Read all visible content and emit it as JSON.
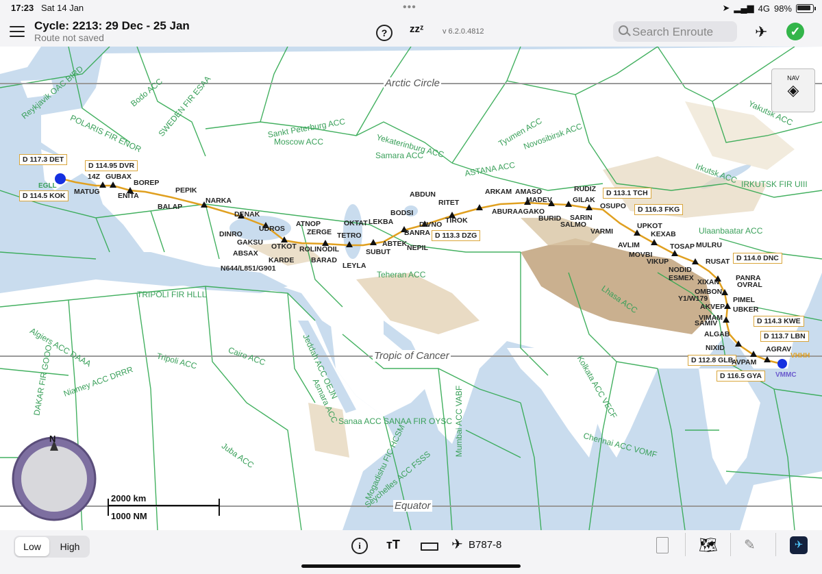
{
  "status_bar": {
    "time": "17:23",
    "date": "Sat 14 Jan",
    "network": "4G",
    "battery": "98%"
  },
  "header": {
    "cycle": "Cycle: 2213: 29 Dec - 25 Jan",
    "route_status": "Route not saved",
    "version": "v 6.2.0.4812",
    "search_placeholder": "Search Enroute",
    "sleep_label": "zzᶻ"
  },
  "map": {
    "lines": {
      "arctic": "Arctic Circle",
      "tropic": "Tropic of Cancer",
      "equator": "Equator"
    },
    "nav_button_label": "NAV",
    "compass_label": "N",
    "scale_km": "2000 km",
    "scale_nm": "1000 NM",
    "regions": [
      "Reykjavik OAC BIRD",
      "Bodo ACC",
      "SWEDEN FIR ESAA",
      "POLARIS FIR ENOR",
      "Sankt Peterburg ACC",
      "Moscow ACC",
      "Yekaterinburg ACC",
      "Samara ACC",
      "Tyumen ACC",
      "Novosibirsk ACC",
      "Yakutsk ACC",
      "ASTANA ACC",
      "Irkutsk ACC",
      "IRKUTSK FIR UIII",
      "Ulaanbaatar ACC",
      "Teheran ACC",
      "Lhasa ACC",
      "TRIPOLI FIR HLLL",
      "Algiers ACC DAAA",
      "Tripoli ACC",
      "Cairo ACC",
      "Niamey ACC DRRR",
      "DAKAR FIR GOOO",
      "Jeddah ACC OEJN",
      "Asmara ACC",
      "Sanaa ACC",
      "SANAA FIR OYSC",
      "Mumbai ACC VABF",
      "Kolkata ACC VECF",
      "Chennai ACC VOMF",
      "Juba ACC",
      "Mogadishu FIC HCSM",
      "Seychelles ACC FSSS"
    ],
    "navaids": [
      "D 117.3 DET",
      "D 114.95 DVR",
      "D 114.5 KOK",
      "D 113.1 TCH",
      "D 116.3 FKG",
      "D 113.3 DZG",
      "D 114.0 DNC",
      "D 114.3 KWE",
      "D 113.7 LBN",
      "D 112.8 GLB",
      "D 116.5 GYA"
    ],
    "waypoints": [
      "14Z",
      "GUBAX",
      "MATUG",
      "ENITA",
      "BOREP",
      "PEPIK",
      "BALAP",
      "NARKA",
      "DENAK",
      "DINRO",
      "UDROS",
      "GAKSU",
      "ABSAX",
      "OTKOT",
      "KARDE",
      "ATNOP",
      "ZERGE",
      "ROLIN",
      "ODIL",
      "BARAD",
      "TETRO",
      "OKTAT",
      "LEKBA",
      "BODSI",
      "LEYLA",
      "SUBUT",
      "ABTEK",
      "NEPIL",
      "BANRA",
      "DIVNO",
      "ABDUN",
      "RITET",
      "TIROK",
      "ARKAM",
      "AMASO",
      "ABURA",
      "AGAKO",
      "MADEV",
      "RUDIZ",
      "GILAK",
      "BURID",
      "OSUPO",
      "SARIN",
      "SALMO",
      "VARMI",
      "UPKOT",
      "KEXAB",
      "AVLIM",
      "MOVBI",
      "VIKUP",
      "TOSAP",
      "MULRU",
      "NODID",
      "ESMEX",
      "RUSAT",
      "XIXAN",
      "PANRA",
      "OVRAL",
      "OMBON",
      "AKVEP",
      "PIMEL",
      "UBKER",
      "VIMAM",
      "SAMIV",
      "ALGAB",
      "NIXID",
      "AGRAV",
      "AVPAM"
    ],
    "airways": [
      "N644/L851/G901",
      "Y1/W179"
    ],
    "airports": {
      "origin": "EGLL",
      "destination": "VHHH",
      "alternate": "VMMC"
    }
  },
  "bottom_bar": {
    "low": "Low",
    "high": "High",
    "aircraft": "B787-8"
  },
  "colors": {
    "route": "#e0a020",
    "boundary": "#2fa84f",
    "terrain": "#b8956a",
    "water": "#c9dcee",
    "ok": "#33b54a"
  }
}
